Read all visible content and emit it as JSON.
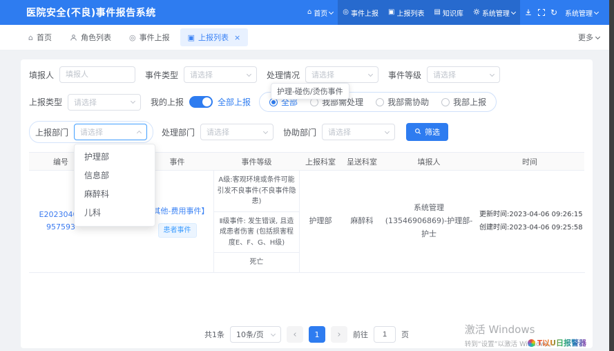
{
  "colors": {
    "primary": "#2e7cf0",
    "accent": "#409eff"
  },
  "icons": {
    "home": "⌂",
    "target": "◎",
    "list": "▣",
    "book": "▤",
    "refresh": "↻",
    "close": "×",
    "prev": "‹",
    "next": "›"
  },
  "header": {
    "title": "医院安全(不良)事件报告系统",
    "nav": [
      {
        "label": "首页"
      },
      {
        "label": "事件上报"
      },
      {
        "label": "上报列表"
      },
      {
        "label": "知识库"
      },
      {
        "label": "系统管理"
      }
    ],
    "user": {
      "label": "系统管理"
    }
  },
  "tabbar": {
    "tabs": [
      {
        "label": "首页"
      },
      {
        "label": "角色列表"
      },
      {
        "label": "事件上报"
      },
      {
        "label": "上报列表"
      }
    ],
    "more_label": "更多"
  },
  "filters": {
    "row1": [
      {
        "label": "填报人",
        "placeholder": "填报人"
      },
      {
        "label": "事件类型",
        "placeholder": "请选择"
      },
      {
        "label": "处理情况",
        "placeholder": "请选择"
      },
      {
        "label": "事件等级",
        "placeholder": "请选择"
      }
    ],
    "tooltip": "护理-碰伤/烫伤事件",
    "row2": {
      "report_type_label": "上报类型",
      "report_type_placeholder": "请选择",
      "my_report_label": "我的上报",
      "toggle_label": "全部上报",
      "radios": [
        {
          "label": "全部"
        },
        {
          "label": "我部需处理"
        },
        {
          "label": "我部需协助"
        },
        {
          "label": "我部上报"
        }
      ]
    },
    "row3": {
      "report_dept_label": "上报部门",
      "report_dept_placeholder": "请选择",
      "handle_dept_label": "处理部门",
      "handle_dept_placeholder": "请选择",
      "assist_dept_label": "协助部门",
      "assist_dept_placeholder": "请选择",
      "filter_button": "筛选"
    },
    "dropdown_options": [
      "护理部",
      "信息部",
      "麻醉科",
      "儿科"
    ]
  },
  "table": {
    "headers": [
      "编号",
      "",
      "事件",
      "事件等级",
      "上报科室",
      "呈送科室",
      "填报人",
      "时间"
    ],
    "row": {
      "id_line1": "E20230406",
      "id_line2": "957593",
      "event_title": "【其他-费用事件】",
      "event_tag": "患者事件",
      "grades": [
        "A级:客观环境或条件可能引发不良事件(不良事件隐患)",
        "Ⅱ级事件: 发生错误, 且造成患者伤害 (包括损害程度E、F、G、H级)",
        "死亡"
      ],
      "report_dept": "护理部",
      "submit_dept": "麻醉科",
      "reporter": "系统管理(13546906869)-护理部-护士",
      "update_time": "更新时间:2023-04-06 09:26:15",
      "create_time": "创建时间:2023-04-06 09:25:58"
    }
  },
  "pagination": {
    "total": "共1条",
    "page_size": "10条/页",
    "page": "1",
    "goto_label": "前往",
    "goto_value": "1",
    "unit": "页"
  },
  "watermark": {
    "line1": "激活 Windows",
    "line2": "转到“设置”以激活 Windows。",
    "badge": "T以U日报警器"
  }
}
